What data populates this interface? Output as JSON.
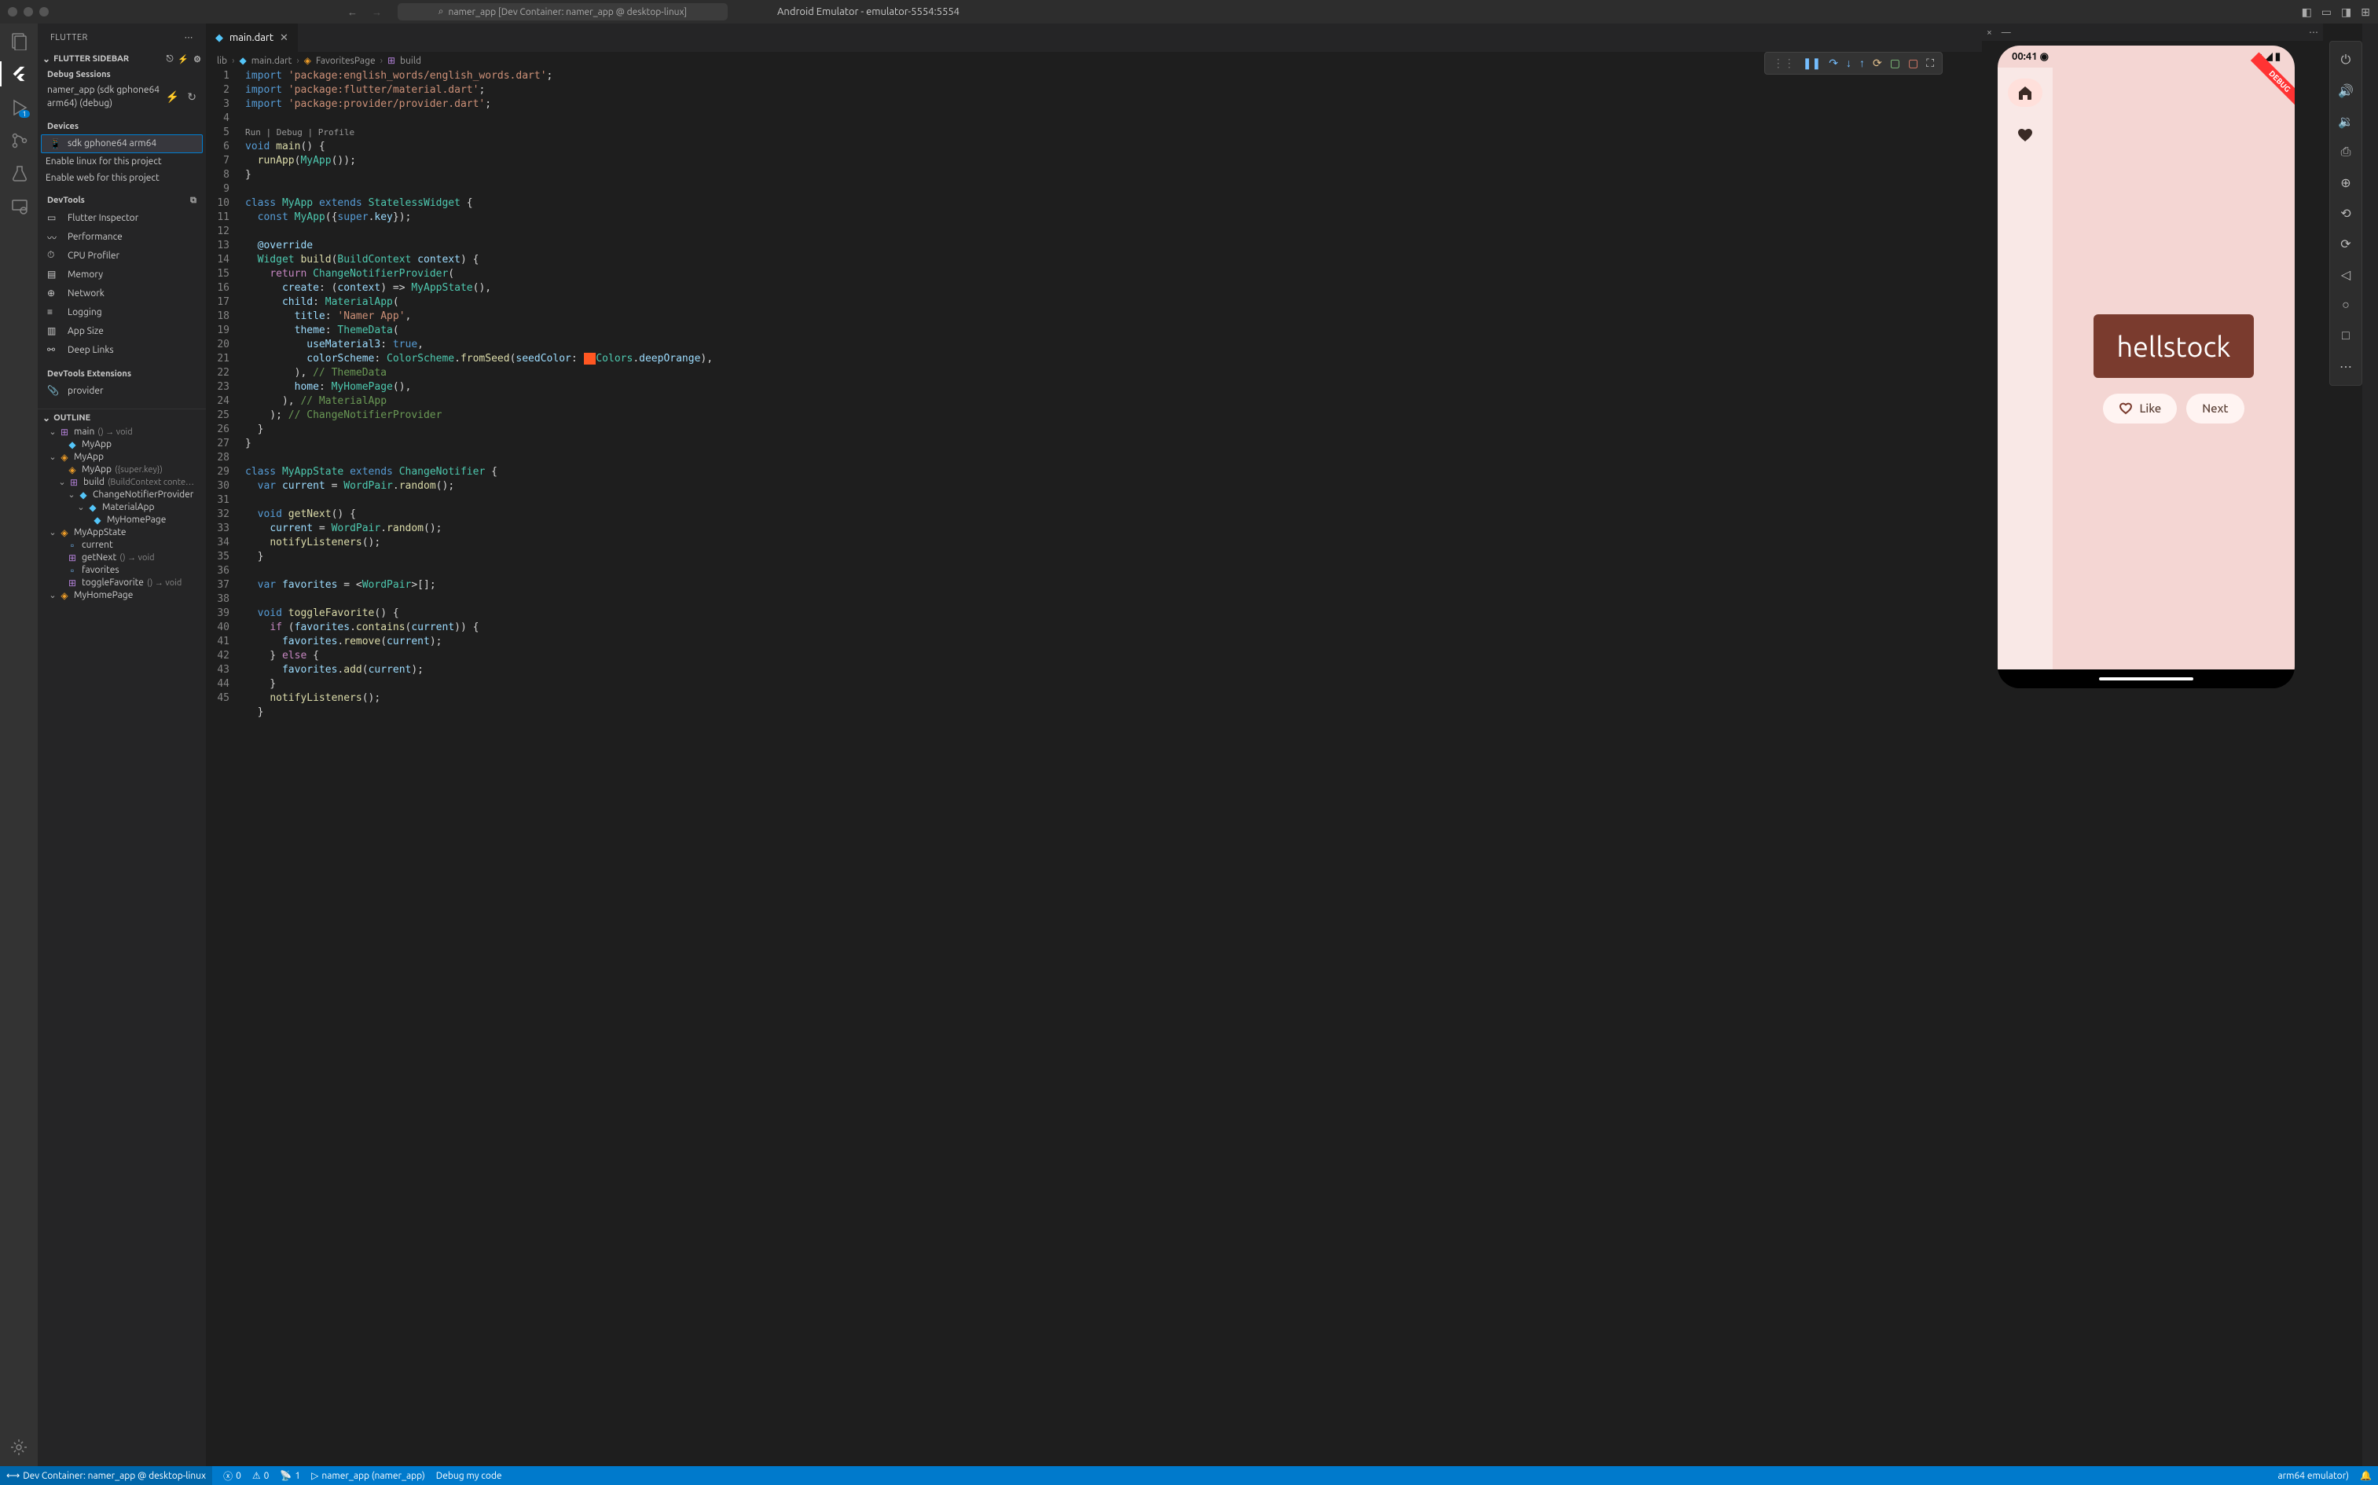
{
  "titlebar": {
    "search": "namer_app [Dev Container: namer_app @ desktop-linux]",
    "emulator_title": "Android Emulator - emulator-5554:5554"
  },
  "sidebar": {
    "panel_title": "FLUTTER",
    "section_title": "FLUTTER SIDEBAR",
    "debug_sessions_label": "Debug Sessions",
    "debug_session_text": "namer_app (sdk gphone64 arm64) (debug)",
    "devices_label": "Devices",
    "device_name": "sdk gphone64 arm64",
    "enable_linux": "Enable linux for this project",
    "enable_web": "Enable web for this project",
    "devtools_label": "DevTools",
    "devtools_items": {
      "inspector": "Flutter Inspector",
      "performance": "Performance",
      "cpu": "CPU Profiler",
      "memory": "Memory",
      "network": "Network",
      "logging": "Logging",
      "appsize": "App Size",
      "deeplinks": "Deep Links"
    },
    "devtools_ext_label": "DevTools Extensions",
    "provider": "provider",
    "outline_label": "OUTLINE",
    "outline": {
      "main": "main",
      "main_sig": "()  →  void",
      "myapp1": "MyApp",
      "myapp2": "MyApp",
      "myapp2_sig": "({super.key})",
      "myapp3": "MyApp",
      "build": "build",
      "build_sig": "(BuildContext conte…",
      "cnp": "ChangeNotifierProvider",
      "material": "MaterialApp",
      "myhome": "MyHomePage",
      "appstate": "MyAppState",
      "current": "current",
      "getnext": "getNext",
      "getnext_sig": "()  →  void",
      "favorites": "favorites",
      "togglefav": "toggleFavorite",
      "togglefav_sig": "()  →  void",
      "myhomepage": "MyHomePage"
    }
  },
  "tabs": {
    "main_dart": "main.dart"
  },
  "breadcrumb": {
    "lib": "lib",
    "main": "main.dart",
    "favpage": "FavoritesPage",
    "build": "build"
  },
  "codelens": {
    "run": "Run",
    "debug": "Debug",
    "profile": "Profile"
  },
  "emulator": {
    "time": "00:41",
    "word": "hellstock",
    "like": "Like",
    "next": "Next",
    "debug_banner": "DEBUG"
  },
  "status": {
    "remote": "Dev Container: namer_app @ desktop-linux",
    "err": "0",
    "warn": "0",
    "port": "1",
    "app": "namer_app (namer_app)",
    "debug": "Debug my code",
    "device": "arm64 emulator)"
  }
}
